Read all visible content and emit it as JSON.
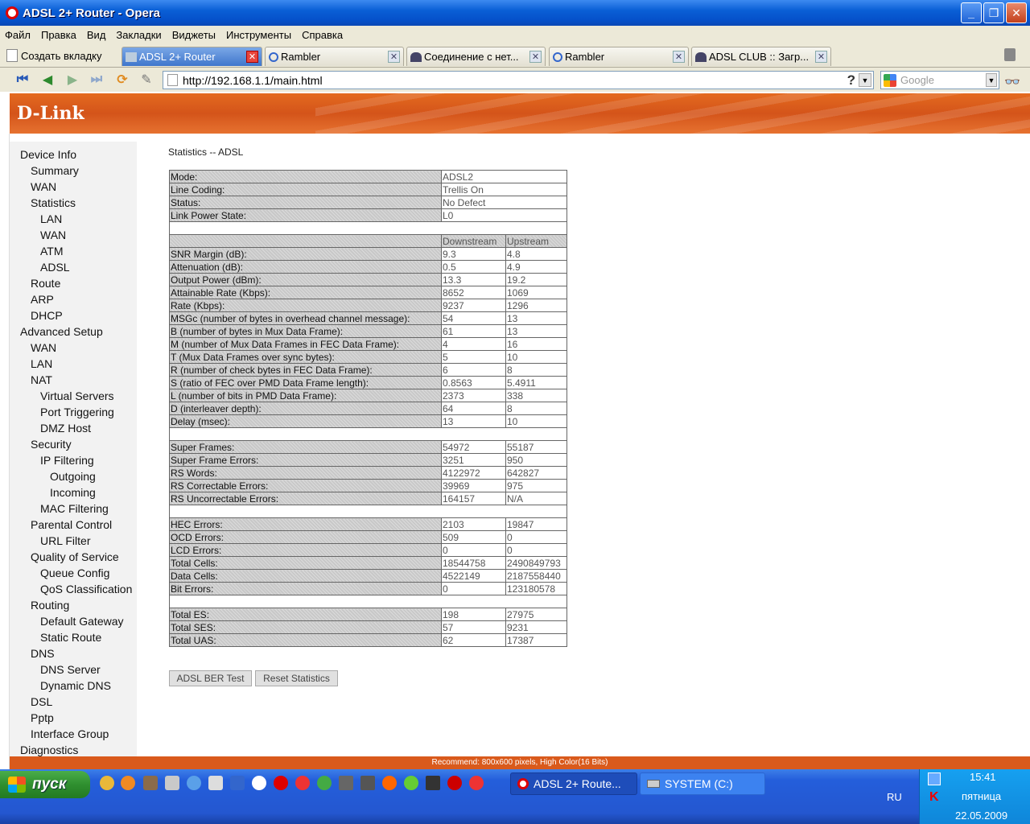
{
  "window": {
    "title": "ADSL 2+ Router - Opera"
  },
  "menu": [
    "Файл",
    "Правка",
    "Вид",
    "Закладки",
    "Виджеты",
    "Инструменты",
    "Справка"
  ],
  "tabs": {
    "new_tab_label": "Создать вкладку",
    "items": [
      {
        "label": "ADSL 2+ Router",
        "active": true
      },
      {
        "label": "Rambler",
        "active": false
      },
      {
        "label": "Соединение с нет...",
        "active": false
      },
      {
        "label": "Rambler",
        "active": false
      },
      {
        "label": "ADSL CLUB :: Загр...",
        "active": false
      }
    ]
  },
  "address": {
    "url": "http://192.168.1.1/main.html",
    "help": "?"
  },
  "search": {
    "placeholder": "Google"
  },
  "banner": {
    "logo": "D-Link"
  },
  "sidebar": [
    {
      "label": "Device Info",
      "level": 0
    },
    {
      "label": "Summary",
      "level": 1
    },
    {
      "label": "WAN",
      "level": 1
    },
    {
      "label": "Statistics",
      "level": 1
    },
    {
      "label": "LAN",
      "level": 2
    },
    {
      "label": "WAN",
      "level": 2
    },
    {
      "label": "ATM",
      "level": 2
    },
    {
      "label": "ADSL",
      "level": 2
    },
    {
      "label": "Route",
      "level": 1
    },
    {
      "label": "ARP",
      "level": 1
    },
    {
      "label": "DHCP",
      "level": 1
    },
    {
      "label": "Advanced Setup",
      "level": 0
    },
    {
      "label": "WAN",
      "level": 1
    },
    {
      "label": "LAN",
      "level": 1
    },
    {
      "label": "NAT",
      "level": 1
    },
    {
      "label": "Virtual Servers",
      "level": 2
    },
    {
      "label": "Port Triggering",
      "level": 2
    },
    {
      "label": "DMZ Host",
      "level": 2
    },
    {
      "label": "Security",
      "level": 1
    },
    {
      "label": "IP Filtering",
      "level": 2
    },
    {
      "label": "Outgoing",
      "level": 3
    },
    {
      "label": "Incoming",
      "level": 3
    },
    {
      "label": "MAC Filtering",
      "level": 2
    },
    {
      "label": "Parental Control",
      "level": 1
    },
    {
      "label": "URL Filter",
      "level": 2
    },
    {
      "label": "Quality of Service",
      "level": 1
    },
    {
      "label": "Queue Config",
      "level": 2
    },
    {
      "label": "QoS Classification",
      "level": 2
    },
    {
      "label": "Routing",
      "level": 1
    },
    {
      "label": "Default Gateway",
      "level": 2
    },
    {
      "label": "Static Route",
      "level": 2
    },
    {
      "label": "DNS",
      "level": 1
    },
    {
      "label": "DNS Server",
      "level": 2
    },
    {
      "label": "Dynamic DNS",
      "level": 2
    },
    {
      "label": "DSL",
      "level": 1
    },
    {
      "label": "Pptp",
      "level": 1
    },
    {
      "label": "Interface Group",
      "level": 1
    },
    {
      "label": "Diagnostics",
      "level": 0
    }
  ],
  "content": {
    "title": "Statistics -- ADSL",
    "status_rows": [
      {
        "label": "Mode:",
        "value": "ADSL2"
      },
      {
        "label": "Line Coding:",
        "value": "Trellis On"
      },
      {
        "label": "Status:",
        "value": "No Defect"
      },
      {
        "label": "Link Power State:",
        "value": "L0"
      }
    ],
    "headers": {
      "down": "Downstream",
      "up": "Upstream"
    },
    "groups": [
      [
        {
          "label": "SNR Margin (dB):",
          "down": "9.3",
          "up": "4.8"
        },
        {
          "label": "Attenuation (dB):",
          "down": "0.5",
          "up": "4.9"
        },
        {
          "label": "Output Power (dBm):",
          "down": "13.3",
          "up": "19.2"
        },
        {
          "label": "Attainable Rate (Kbps):",
          "down": "8652",
          "up": "1069"
        },
        {
          "label": "Rate (Kbps):",
          "down": "9237",
          "up": "1296"
        },
        {
          "label": "MSGc (number of bytes in overhead channel message):",
          "down": "54",
          "up": "13"
        },
        {
          "label": "B (number of bytes in Mux Data Frame):",
          "down": "61",
          "up": "13"
        },
        {
          "label": "M (number of Mux Data Frames in FEC Data Frame):",
          "down": "4",
          "up": "16"
        },
        {
          "label": "T (Mux Data Frames over sync bytes):",
          "down": "5",
          "up": "10"
        },
        {
          "label": "R (number of check bytes in FEC Data Frame):",
          "down": "6",
          "up": "8"
        },
        {
          "label": "S (ratio of FEC over PMD Data Frame length):",
          "down": "0.8563",
          "up": "5.4911"
        },
        {
          "label": "L (number of bits in PMD Data Frame):",
          "down": "2373",
          "up": "338"
        },
        {
          "label": "D (interleaver depth):",
          "down": "64",
          "up": "8"
        },
        {
          "label": "Delay (msec):",
          "down": "13",
          "up": "10"
        }
      ],
      [
        {
          "label": "Super Frames:",
          "down": "54972",
          "up": "55187"
        },
        {
          "label": "Super Frame Errors:",
          "down": "3251",
          "up": "950"
        },
        {
          "label": "RS Words:",
          "down": "4122972",
          "up": "642827"
        },
        {
          "label": "RS Correctable Errors:",
          "down": "39969",
          "up": "975"
        },
        {
          "label": "RS Uncorrectable Errors:",
          "down": "164157",
          "up": "N/A"
        }
      ],
      [
        {
          "label": "HEC Errors:",
          "down": "2103",
          "up": "19847"
        },
        {
          "label": "OCD Errors:",
          "down": "509",
          "up": "0"
        },
        {
          "label": "LCD Errors:",
          "down": "0",
          "up": "0"
        },
        {
          "label": "Total Cells:",
          "down": "18544758",
          "up": "2490849793"
        },
        {
          "label": "Data Cells:",
          "down": "4522149",
          "up": "2187558440"
        },
        {
          "label": "Bit Errors:",
          "down": "0",
          "up": "123180578"
        }
      ],
      [
        {
          "label": "Total ES:",
          "down": "198",
          "up": "27975"
        },
        {
          "label": "Total SES:",
          "down": "57",
          "up": "9231"
        },
        {
          "label": "Total UAS:",
          "down": "62",
          "up": "17387"
        }
      ]
    ],
    "buttons": {
      "ber_test": "ADSL BER Test",
      "reset": "Reset Statistics"
    },
    "footer": "Recommend: 800x600 pixels, High Color(16 Bits)"
  },
  "taskbar": {
    "start": "пуск",
    "items": [
      {
        "label": "ADSL 2+ Route...",
        "active": true
      },
      {
        "label": "SYSTEM (C:)",
        "active": false
      }
    ],
    "lang": "RU",
    "time": "15:41",
    "day": "пятница",
    "date": "22.05.2009"
  }
}
